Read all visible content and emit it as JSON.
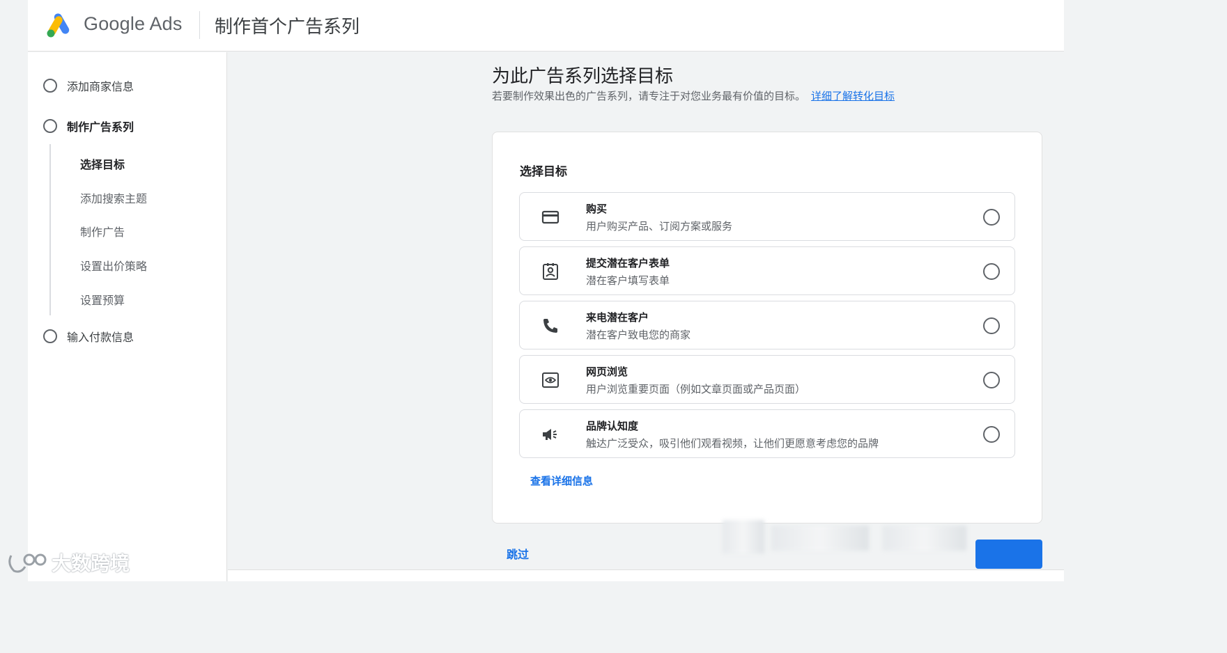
{
  "header": {
    "brand": "Google Ads",
    "title": "制作首个广告系列"
  },
  "sidebar": {
    "steps": [
      {
        "label": "添加商家信息"
      },
      {
        "label": "制作广告系列"
      },
      {
        "label": "输入付款信息"
      }
    ],
    "substeps": [
      {
        "label": "选择目标",
        "active": true
      },
      {
        "label": "添加搜索主题"
      },
      {
        "label": "制作广告"
      },
      {
        "label": "设置出价策略"
      },
      {
        "label": "设置预算"
      }
    ]
  },
  "main": {
    "title": "为此广告系列选择目标",
    "description": "若要制作效果出色的广告系列，请专注于对您业务最有价值的目标。",
    "learn_more": "详细了解转化目标",
    "card_heading": "选择目标",
    "options": [
      {
        "icon": "credit-card-icon",
        "title": "购买",
        "desc": "用户购买产品、订阅方案或服务"
      },
      {
        "icon": "contact-form-icon",
        "title": "提交潜在客户表单",
        "desc": "潜在客户填写表单"
      },
      {
        "icon": "phone-icon",
        "title": "来电潜在客户",
        "desc": "潜在客户致电您的商家"
      },
      {
        "icon": "web-view-icon",
        "title": "网页浏览",
        "desc": "用户浏览重要页面（例如文章页面或产品页面）"
      },
      {
        "icon": "megaphone-icon",
        "title": "品牌认知度",
        "desc": "触达广泛受众，吸引他们观看视频，让他们更愿意考虑您的品牌"
      }
    ],
    "more_link": "查看详细信息",
    "skip": "跳过"
  },
  "watermark": {
    "text": "大数跨境"
  },
  "colors": {
    "accent": "#1a73e8",
    "logo_blue": "#4285f4",
    "logo_yellow": "#fbbc04",
    "logo_green": "#34a853"
  }
}
